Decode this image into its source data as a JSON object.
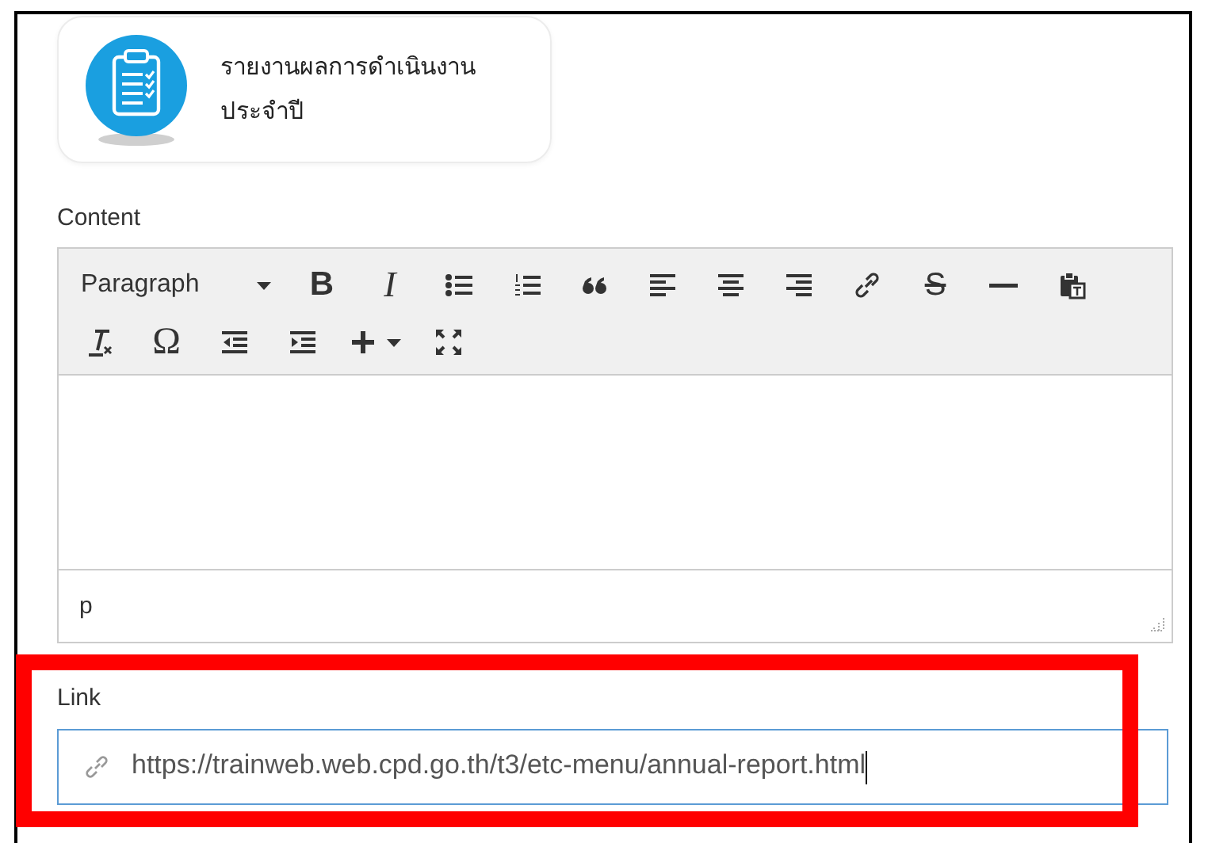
{
  "card": {
    "title_lines": [
      "รายงานผลการดำเนินงาน",
      "ประจำปี"
    ]
  },
  "content_editor": {
    "label": "Content",
    "toolbar_rows": [
      [
        {
          "kind": "dropdown",
          "text": "Paragraph"
        },
        {
          "kind": "bold",
          "text": "B"
        },
        {
          "kind": "italic",
          "text": "I"
        },
        {
          "kind": "bullets"
        },
        {
          "kind": "numbers"
        },
        {
          "kind": "quote"
        },
        {
          "kind": "alignleft"
        },
        {
          "kind": "aligncenter"
        },
        {
          "kind": "alignright"
        },
        {
          "kind": "link"
        },
        {
          "kind": "strike",
          "text": "S"
        },
        {
          "kind": "rule"
        },
        {
          "kind": "paste"
        }
      ],
      [
        {
          "kind": "clearformat"
        },
        {
          "kind": "omega",
          "text": "Ω"
        },
        {
          "kind": "outdent"
        },
        {
          "kind": "indent"
        },
        {
          "kind": "insert"
        },
        {
          "kind": "fullscreen"
        }
      ]
    ],
    "status_path": "p"
  },
  "link": {
    "label": "Link",
    "value": "https://trainweb.web.cpd.go.th/t3/etc-menu/annual-report.html",
    "focused": true,
    "highlighted": true
  }
}
